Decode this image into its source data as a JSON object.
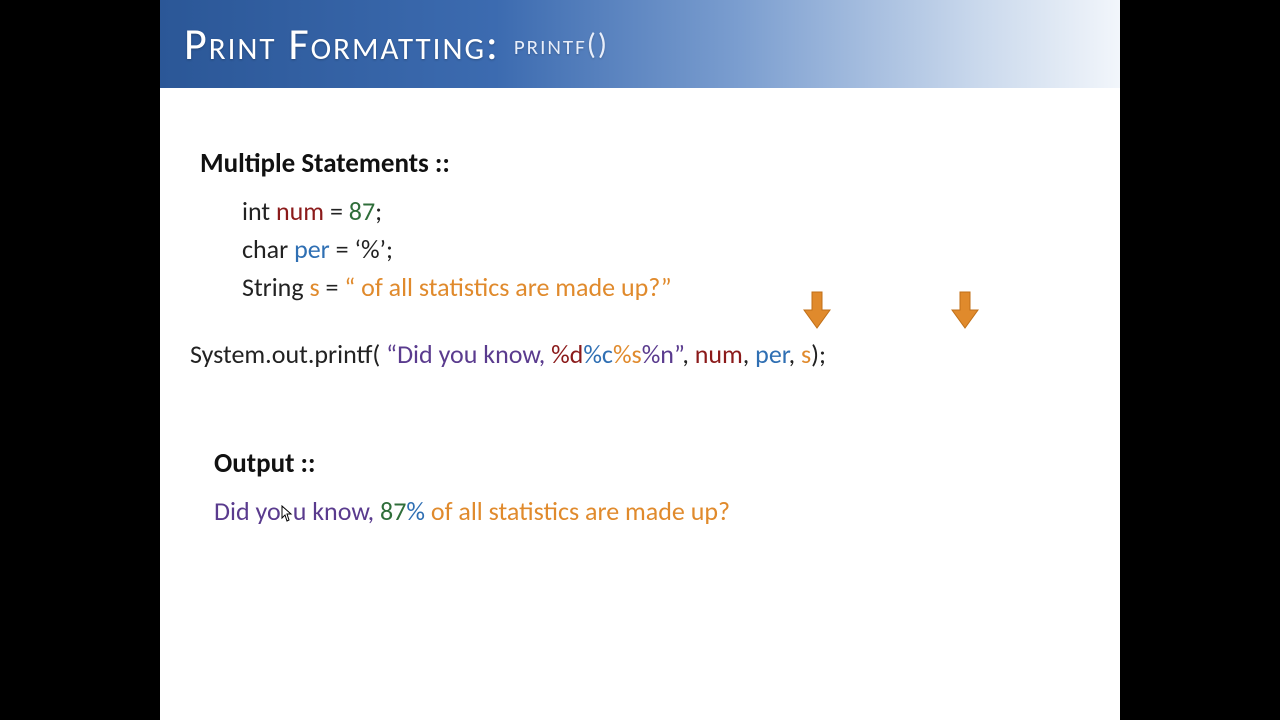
{
  "title": {
    "main": "Print Formatting:",
    "sub": "printf()"
  },
  "headings": {
    "multiple": "Multiple Statements ::",
    "output": "Output ::"
  },
  "decl": {
    "l1_kw": "int ",
    "l1_var": "num",
    "l1_eq": " = ",
    "l1_val": "87",
    "l1_end": ";",
    "l2_kw": "char ",
    "l2_var": "per",
    "l2_eq": " = ",
    "l2_val": "‘%’",
    "l2_end": ";",
    "l3_kw": "String ",
    "l3_var": "s",
    "l3_eq": " = ",
    "l3_val": "“ of all statistics are made up?”"
  },
  "printf": {
    "pre": "System.out.printf( ",
    "open_quote": "“",
    "literal": "Did you know, ",
    "fmt_d": "%d",
    "fmt_c": "%c",
    "fmt_s": "%s",
    "fmt_n": "%n",
    "close_quote": "”",
    "comma1": ", ",
    "arg1": "num",
    "comma2": ", ",
    "arg2": "per",
    "comma3": ", ",
    "arg3": "s",
    "end": ");"
  },
  "output": {
    "part1": "Did yo",
    "part1b": "u know, ",
    "num": "87",
    "pct": "%",
    "rest": " of all statistics are made up?"
  }
}
